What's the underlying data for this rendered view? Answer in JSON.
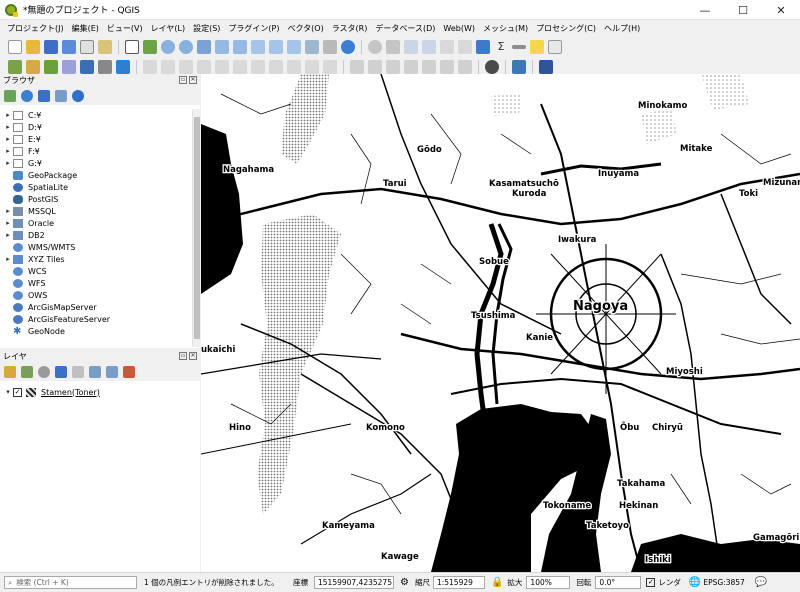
{
  "window": {
    "title": "*無題のプロジェクト - QGIS",
    "controls": [
      "—",
      "☐",
      "✕"
    ]
  },
  "menubar": [
    "プロジェクト(J)",
    "編集(E)",
    "ビュー(V)",
    "レイヤ(L)",
    "設定(S)",
    "プラグイン(P)",
    "ベクタ(O)",
    "ラスタ(R)",
    "データベース(D)",
    "Web(W)",
    "メッシュ(M)",
    "プロセシング(C)",
    "ヘルプ(H)"
  ],
  "browser_panel": {
    "title": "ブラウザ",
    "items": [
      {
        "label": "C:¥",
        "icon": "drive-icon",
        "expandable": true
      },
      {
        "label": "D:¥",
        "icon": "drive-icon",
        "expandable": true
      },
      {
        "label": "E:¥",
        "icon": "drive-icon",
        "expandable": true
      },
      {
        "label": "F:¥",
        "icon": "drive-icon",
        "expandable": true
      },
      {
        "label": "G:¥",
        "icon": "drive-icon",
        "expandable": true
      },
      {
        "label": "GeoPackage",
        "icon": "geopackage-icon",
        "expandable": false
      },
      {
        "label": "SpatiaLite",
        "icon": "spatialite-icon",
        "expandable": false
      },
      {
        "label": "PostGIS",
        "icon": "postgis-icon",
        "expandable": false
      },
      {
        "label": "MSSQL",
        "icon": "mssql-icon",
        "expandable": true
      },
      {
        "label": "Oracle",
        "icon": "oracle-icon",
        "expandable": true
      },
      {
        "label": "DB2",
        "icon": "db2-icon",
        "expandable": true
      },
      {
        "label": "WMS/WMTS",
        "icon": "wms-icon",
        "expandable": false
      },
      {
        "label": "XYZ Tiles",
        "icon": "xyz-tiles-icon",
        "expandable": true
      },
      {
        "label": "WCS",
        "icon": "wcs-icon",
        "expandable": false
      },
      {
        "label": "WFS",
        "icon": "wfs-icon",
        "expandable": false
      },
      {
        "label": "OWS",
        "icon": "ows-icon",
        "expandable": false
      },
      {
        "label": "ArcGisMapServer",
        "icon": "arcgis-map-icon",
        "expandable": false
      },
      {
        "label": "ArcGisFeatureServer",
        "icon": "arcgis-feature-icon",
        "expandable": false
      },
      {
        "label": "GeoNode",
        "icon": "geonode-icon",
        "expandable": false
      }
    ]
  },
  "layers_panel": {
    "title": "レイヤ",
    "layers": [
      {
        "name": "Stamen(Toner)",
        "checked": true
      }
    ]
  },
  "map": {
    "labels": [
      {
        "text": "Minokamo"
      },
      {
        "text": "Gōdo"
      },
      {
        "text": "Mitake"
      },
      {
        "text": "Nagahama"
      },
      {
        "text": "Tarui"
      },
      {
        "text": "Kasamatsuchō"
      },
      {
        "text": "Inuyama"
      },
      {
        "text": "Kuroda"
      },
      {
        "text": "Toki"
      },
      {
        "text": "Mizunami"
      },
      {
        "text": "Iwakura"
      },
      {
        "text": "Sobue"
      },
      {
        "text": "Nagoya"
      },
      {
        "text": "Tsushima"
      },
      {
        "text": "Kanie"
      },
      {
        "text": "ukaichi"
      },
      {
        "text": "Miyoshi"
      },
      {
        "text": "Hino"
      },
      {
        "text": "Komono"
      },
      {
        "text": "Ōbu"
      },
      {
        "text": "Chiryū"
      },
      {
        "text": "Takahama"
      },
      {
        "text": "Hekinan"
      },
      {
        "text": "Tokoname"
      },
      {
        "text": "Kameyama"
      },
      {
        "text": "Taketoyo"
      },
      {
        "text": "Kawage"
      },
      {
        "text": "Ishiki"
      },
      {
        "text": "Gamagōri"
      }
    ]
  },
  "statusbar": {
    "search_placeholder": "検索 (Ctrl + K)",
    "message": "1 個の凡例エントリが削除されました。",
    "coord_label": "座標",
    "coord_value": "15159907,4235275",
    "scale_label": "縮尺",
    "scale_value": "1:515929",
    "magnifier_label": "拡大",
    "magnifier_value": "100%",
    "rotation_label": "回転",
    "rotation_value": "0.0°",
    "render_label": "レンダ",
    "crs": "EPSG:3857"
  }
}
